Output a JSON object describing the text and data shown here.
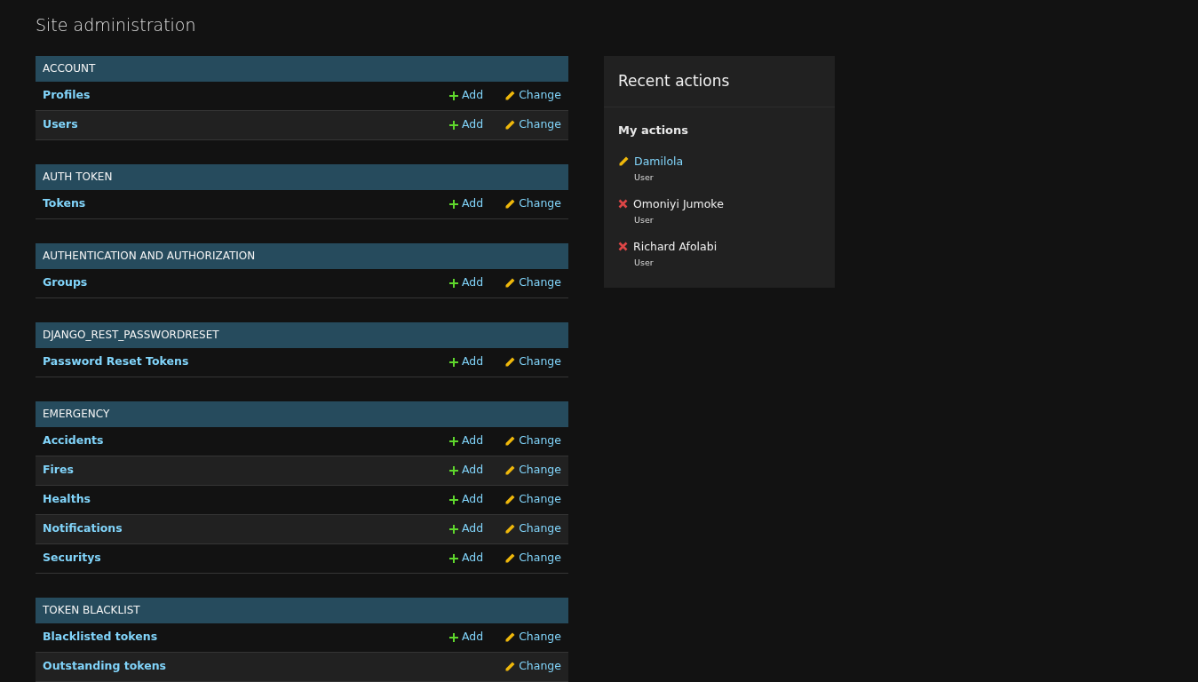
{
  "title": "Site administration",
  "modules": [
    {
      "caption": "ACCOUNT",
      "rows": [
        {
          "name": "Profiles",
          "add": "Add",
          "change": "Change"
        },
        {
          "name": "Users",
          "add": "Add",
          "change": "Change"
        }
      ]
    },
    {
      "caption": "AUTH TOKEN",
      "rows": [
        {
          "name": "Tokens",
          "add": "Add",
          "change": "Change"
        }
      ]
    },
    {
      "caption": "AUTHENTICATION AND AUTHORIZATION",
      "rows": [
        {
          "name": "Groups",
          "add": "Add",
          "change": "Change"
        }
      ]
    },
    {
      "caption": "DJANGO_REST_PASSWORDRESET",
      "rows": [
        {
          "name": "Password Reset Tokens",
          "add": "Add",
          "change": "Change"
        }
      ]
    },
    {
      "caption": "EMERGENCY",
      "rows": [
        {
          "name": "Accidents",
          "add": "Add",
          "change": "Change"
        },
        {
          "name": "Fires",
          "add": "Add",
          "change": "Change"
        },
        {
          "name": "Healths",
          "add": "Add",
          "change": "Change"
        },
        {
          "name": "Notifications",
          "add": "Add",
          "change": "Change"
        },
        {
          "name": "Securitys",
          "add": "Add",
          "change": "Change"
        }
      ]
    },
    {
      "caption": "TOKEN BLACKLIST",
      "rows": [
        {
          "name": "Blacklisted tokens",
          "add": "Add",
          "change": "Change"
        },
        {
          "name": "Outstanding tokens",
          "change": "Change"
        }
      ]
    }
  ],
  "recent_actions": {
    "title": "Recent actions",
    "subtitle": "My actions",
    "items": [
      {
        "kind": "change",
        "name": "Damilola",
        "type": "User"
      },
      {
        "kind": "delete",
        "name": "Omoniyi Jumoke",
        "type": "User"
      },
      {
        "kind": "delete",
        "name": "Richard Afolabi",
        "type": "User"
      }
    ]
  }
}
